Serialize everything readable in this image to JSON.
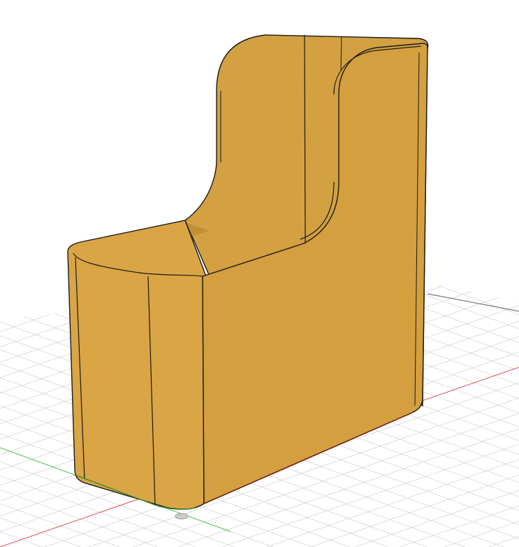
{
  "viewport": {
    "background": "#ffffff",
    "grid_color": "#d4d4d4",
    "grid_major_color": "#7a7a7a",
    "x_axis_color": "#e0505a",
    "y_axis_color": "#4cc04c",
    "model_color": "#d6a040",
    "model_shade_color": "#c48e30",
    "edge_color": "#1a1a1a",
    "origin_icon": "origin-marker-icon"
  }
}
